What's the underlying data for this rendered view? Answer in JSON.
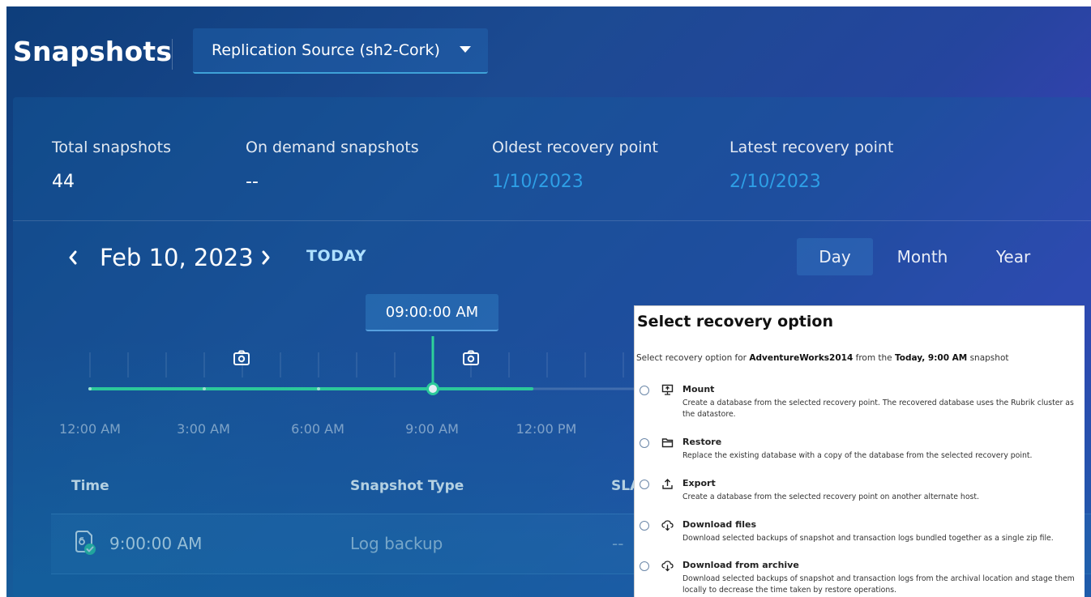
{
  "header": {
    "title": "Snapshots",
    "source_dropdown": "Replication Source (sh2-Cork)"
  },
  "stats": [
    {
      "label": "Total snapshots",
      "value": "44"
    },
    {
      "label": "On demand snapshots",
      "value": "--"
    },
    {
      "label": "Oldest recovery point",
      "value": "1/10/2023"
    },
    {
      "label": "Latest recovery point",
      "value": "2/10/2023"
    }
  ],
  "date_nav": {
    "date": "Feb 10, 2023",
    "today_label": "TODAY",
    "periods": [
      "Day",
      "Month",
      "Year"
    ],
    "active_period": "Day"
  },
  "timeline": {
    "tooltip": "09:00:00 AM",
    "tick_labels": [
      "12:00 AM",
      "3:00 AM",
      "6:00 AM",
      "9:00 AM",
      "12:00 PM"
    ],
    "selected_time": "9:00 AM"
  },
  "table": {
    "columns": [
      "Time",
      "Snapshot Type",
      "SLA"
    ],
    "rows": [
      {
        "time": "9:00:00 AM",
        "type": "Log backup",
        "sla": "--"
      }
    ]
  },
  "dialog": {
    "title": "Select recovery option",
    "subtitle_pre": "Select recovery option for ",
    "subtitle_db": "AdventureWorks2014",
    "subtitle_mid": " from the ",
    "subtitle_snapshot": "Today, 9:00 AM",
    "subtitle_post": " snapshot",
    "options": [
      {
        "icon": "mount-icon",
        "title": "Mount",
        "desc": "Create a database from the selected recovery point. The recovered database uses the Rubrik cluster as the datastore."
      },
      {
        "icon": "folder-icon",
        "title": "Restore",
        "desc": "Replace the existing database with a copy of the database from the selected recovery point."
      },
      {
        "icon": "export-icon",
        "title": "Export",
        "desc": "Create a database from the selected recovery point on another alternate host."
      },
      {
        "icon": "cloud-download-icon",
        "title": "Download files",
        "desc": "Download selected backups of snapshot and transaction logs bundled together as a single zip file."
      },
      {
        "icon": "cloud-download-icon",
        "title": "Download from archive",
        "desc": "Download selected backups of snapshot and transaction logs from the archival location and stage them locally to decrease the time taken by restore operations."
      }
    ]
  },
  "colors": {
    "accent_green": "#2fd49a",
    "link_blue": "#2e9fe6",
    "today_link": "#aee0ff"
  }
}
